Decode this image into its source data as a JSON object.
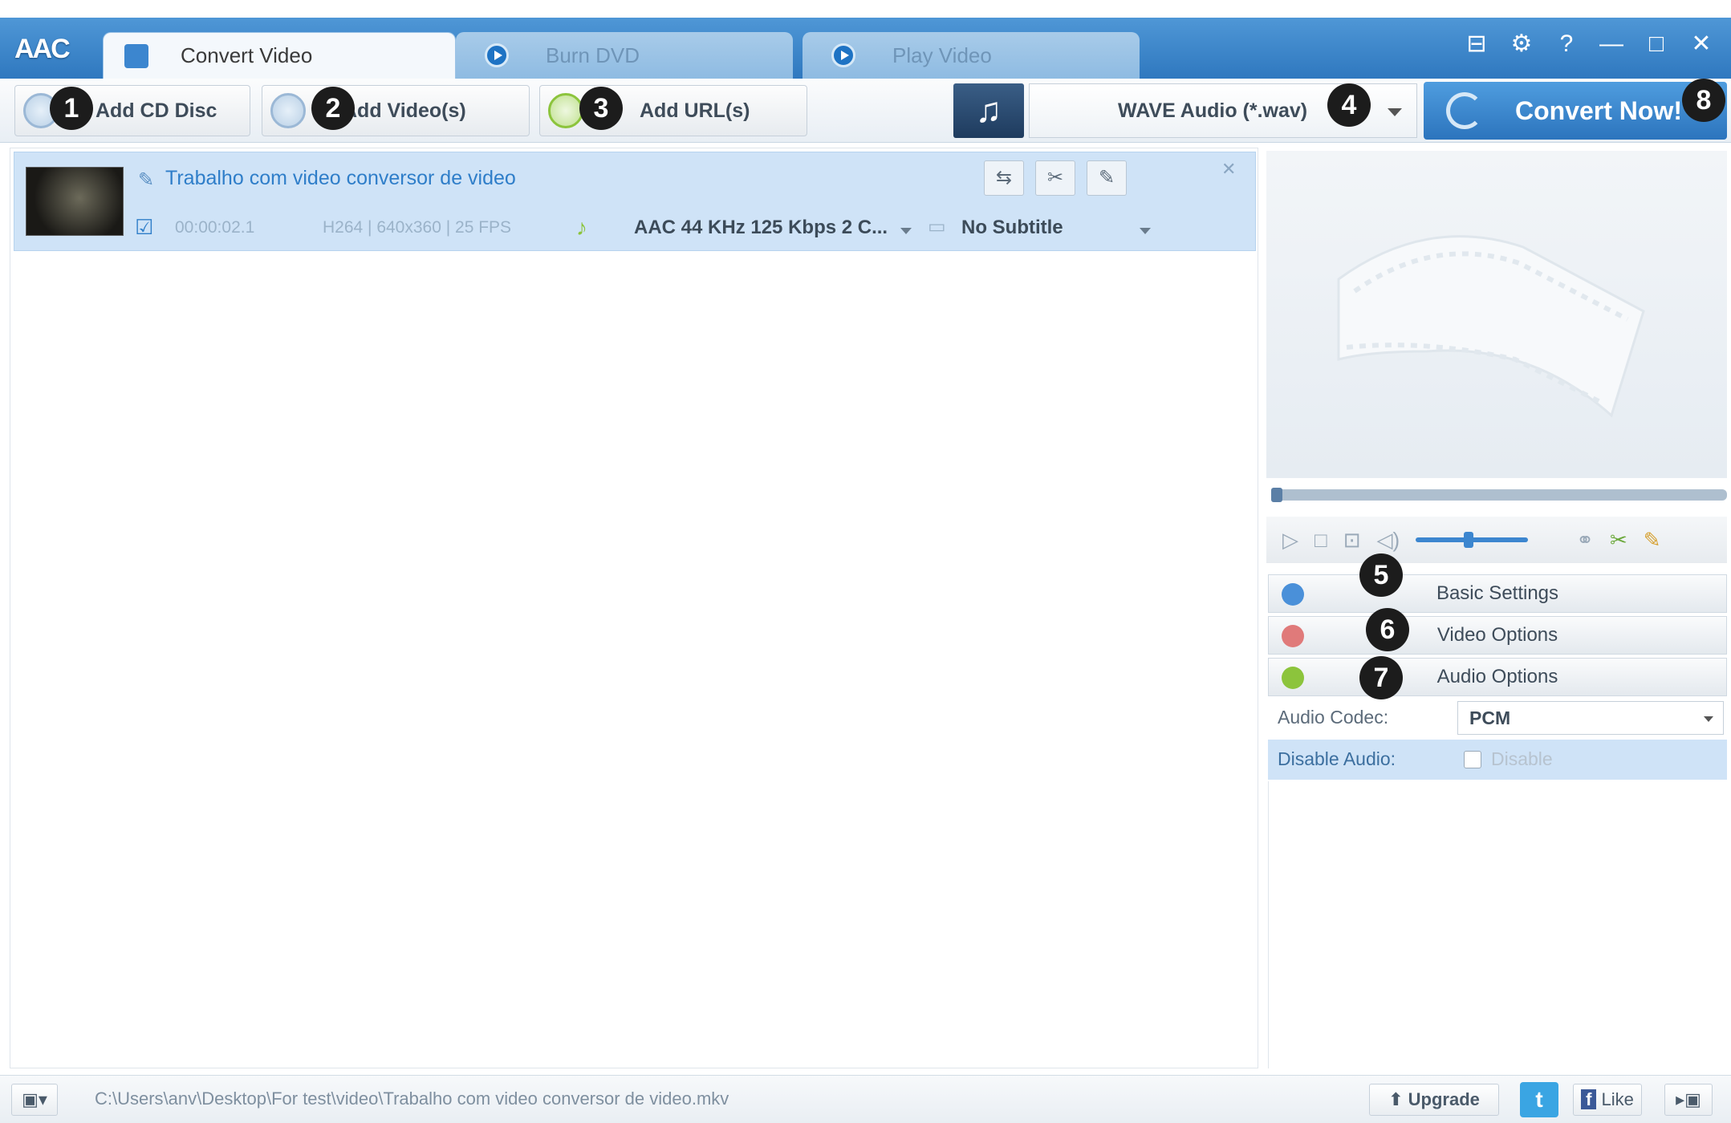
{
  "app": {
    "logo": "AAC"
  },
  "tabs": [
    {
      "label": "Convert Video",
      "active": true
    },
    {
      "label": "Burn DVD",
      "active": false
    },
    {
      "label": "Play Video",
      "active": false
    }
  ],
  "window_controls": [
    "⊟",
    "⚙",
    "?",
    "—",
    "□",
    "✕"
  ],
  "toolbar": {
    "add_cd_label": "Add CD Disc",
    "add_video_label": "Add Video(s)",
    "add_url_label": "Add URL(s)",
    "output_format": "WAVE Audio (*.wav)",
    "convert_label": "Convert Now!",
    "format_icon": "♫"
  },
  "badges": [
    "1",
    "2",
    "3",
    "4",
    "5",
    "6",
    "7",
    "8"
  ],
  "file": {
    "name": "Trabalho com video conversor de video",
    "duration": "00:00:02.1",
    "video_info": "H264 | 640x360 | 25 FPS",
    "audio_track": "AAC 44 KHz 125 Kbps 2 C...",
    "subtitle": "No Subtitle",
    "row_buttons": [
      "⇆",
      "✂",
      "✎"
    ]
  },
  "right_panel": {
    "sections": [
      "Basic Settings",
      "Video Options",
      "Audio Options"
    ],
    "section_colors": [
      "#4a90d9",
      "#e07a7a",
      "#8cc43c"
    ],
    "audio_codec_label": "Audio Codec:",
    "audio_codec_value": "PCM",
    "disable_audio_label": "Disable Audio:",
    "disable_checkbox_label": "Disable"
  },
  "status": {
    "path": "C:\\Users\\anv\\Desktop\\For test\\video\\Trabalho com video conversor de video.mkv",
    "upgrade_label": "Upgrade",
    "like_label": "Like"
  },
  "colors": {
    "accent": "#2f78bf",
    "selected_row": "#cfe3f7"
  }
}
